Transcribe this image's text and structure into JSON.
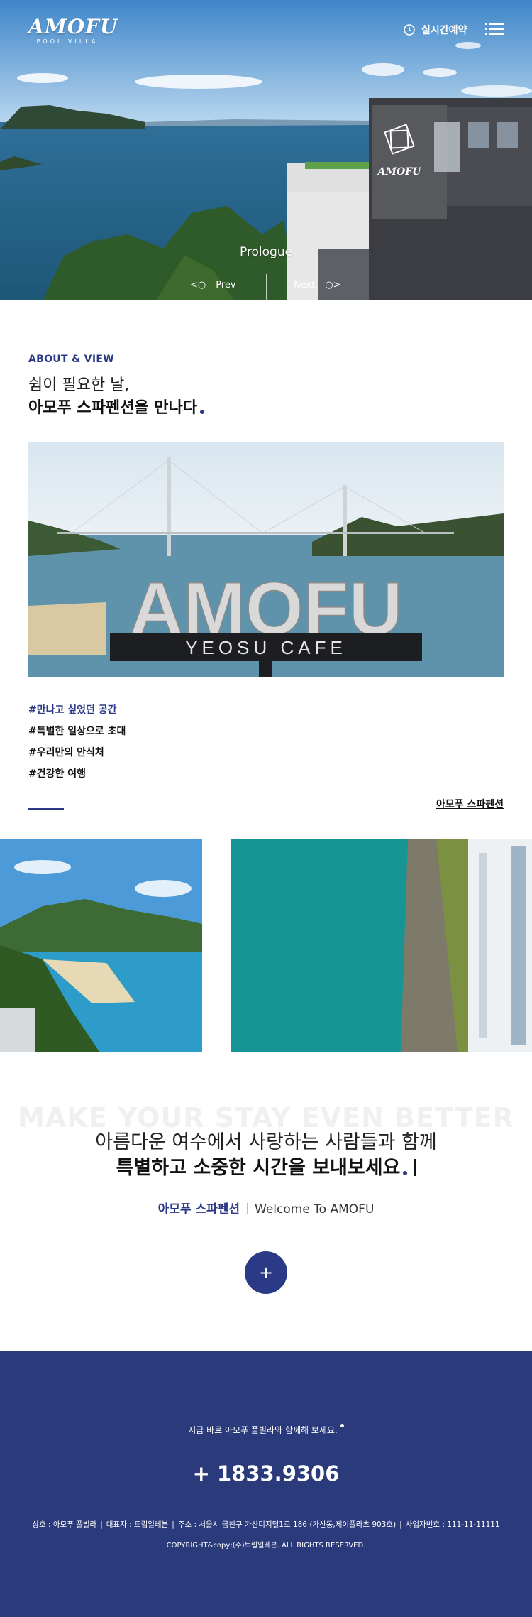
{
  "header": {
    "logo_text": "AMOFU",
    "logo_sub": "POOL VILLA",
    "reserve_label": "실시간예약",
    "menu_icon": "hamburger-icon"
  },
  "hero": {
    "slide_title": "Prologue",
    "prev_label": "Prev",
    "next_label": "Next",
    "building_sign": "AMOFU"
  },
  "about": {
    "eyebrow": "ABOUT & VIEW",
    "line1": "쉼이 필요한 날,",
    "line2": "아모푸 스파펜션을 만나다",
    "sign_big": "AMOFU",
    "sign_sub": "YEOSU CAFE",
    "tags": [
      "#만나고 싶었던 공간",
      "#특별한 일상으로 초대",
      "#우리만의 안식처",
      "#건강한 여행"
    ],
    "link_label": "아모푸 스파펜션"
  },
  "message": {
    "bg_text": "MAKE YOUR STAY EVEN BETTER",
    "line1": "아름다운 여수에서 사랑하는 사람들과 함께",
    "line2": "특별하고 소중한 시간을 보내보세요",
    "welcome_ko": "아모푸 스파펜션",
    "welcome_en": "Welcome To AMOFU",
    "plus_label": "+"
  },
  "footer": {
    "cta": "지금 바로 아모푸 풀빌라와 함께해 보세요.",
    "phone": "+ 1833.9306",
    "biz_items": [
      "상호 : 아모푸 풀빌라",
      "대표자 : 트립일레븐",
      "주소 : 서울시 금천구 가산디지털1로 186 (가산동,제이플라츠 903호)",
      "사업자번호 : 111-11-11111"
    ],
    "copyright": "COPYRIGHT&copy;(주)트립일레븐. ALL RIGHTS RESERVED."
  },
  "colors": {
    "brand_navy": "#2b3a86",
    "footer_bg": "#2b3a7a"
  }
}
